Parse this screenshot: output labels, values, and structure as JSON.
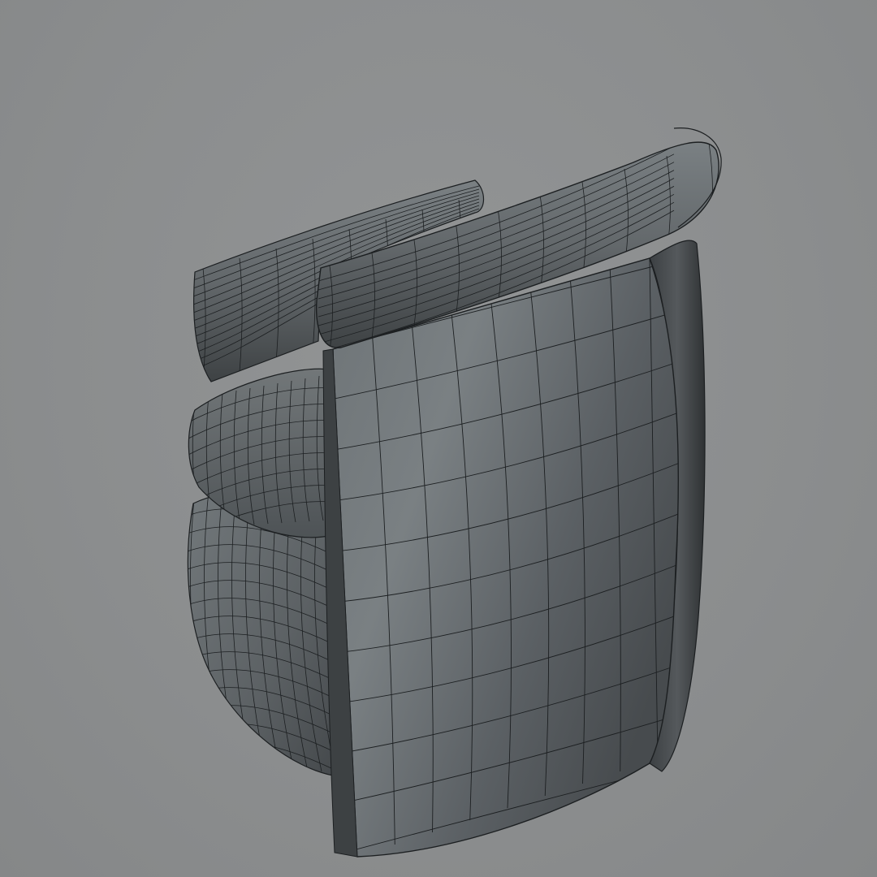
{
  "viewport": {
    "background_color": "#8b8d8e",
    "object_color": "#5e6366",
    "wire_color": "#1c1f21"
  },
  "model": {
    "subject": "armchair",
    "display_mode": "shaded-wireframe"
  }
}
